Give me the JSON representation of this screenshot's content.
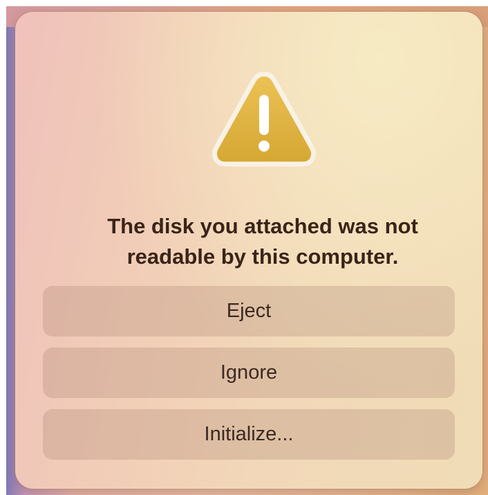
{
  "dialog": {
    "icon": "warning-triangle-icon",
    "message_line1": "The disk you attached was not",
    "message_line2": "readable by this computer.",
    "buttons": {
      "eject": "Eject",
      "ignore": "Ignore",
      "initialize": "Initialize..."
    }
  },
  "colors": {
    "icon_fill": "#e0b440",
    "message_text": "#3a2418"
  }
}
